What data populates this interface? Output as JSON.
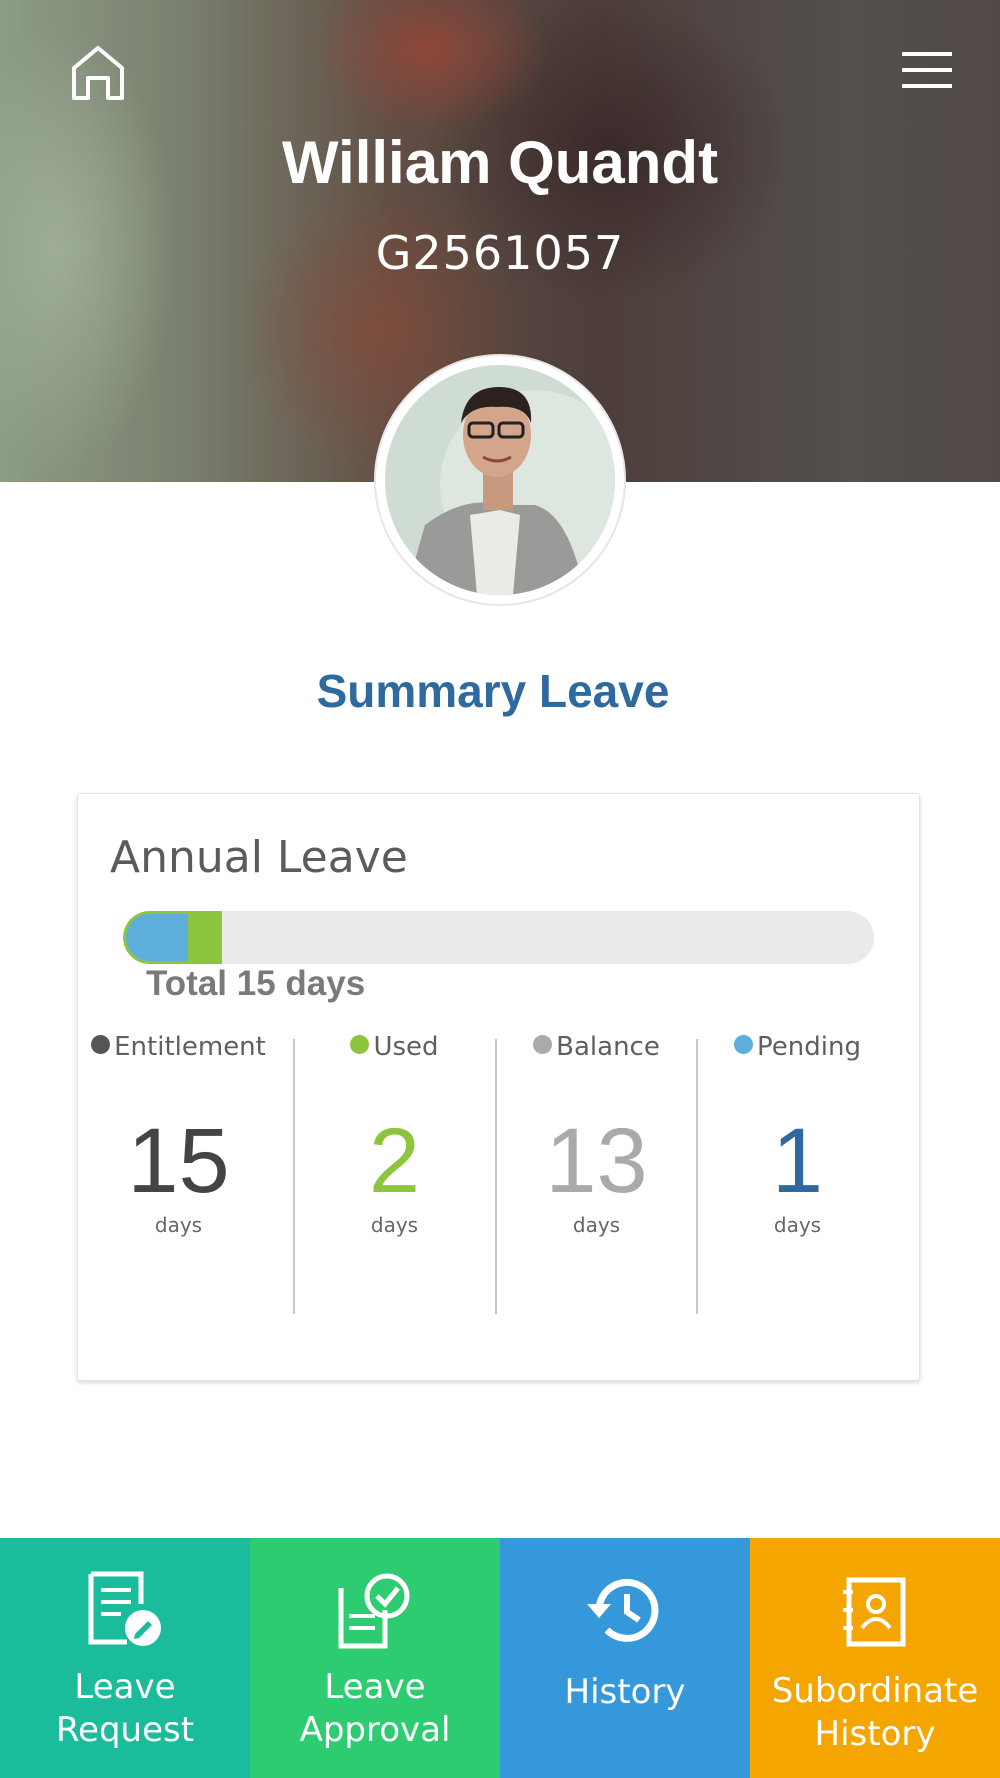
{
  "header": {
    "name": "William Quandt",
    "employee_id": "G2561057",
    "home_icon": "home-icon",
    "menu_icon": "hamburger-menu-icon"
  },
  "summary": {
    "title": "Summary Leave"
  },
  "annual_leave": {
    "title": "Annual Leave",
    "total_label": "Total 15 days",
    "bar": {
      "total_days": 15,
      "pending": 1,
      "used": 2
    },
    "stats": [
      {
        "label": "Entitlement",
        "value": "15",
        "unit": "days",
        "color": "#555555"
      },
      {
        "label": "Used",
        "value": "2",
        "unit": "days",
        "color": "#8cc63e"
      },
      {
        "label": "Balance",
        "value": "13",
        "unit": "days",
        "color": "#aaaaaa"
      },
      {
        "label": "Pending",
        "value": "1",
        "unit": "days",
        "color": "#5eaedb"
      }
    ]
  },
  "nav": [
    {
      "label": "Leave\nRequest",
      "icon": "leave-request-icon",
      "color": "#1abc9c"
    },
    {
      "label": "Leave\nApproval",
      "icon": "leave-approval-icon",
      "color": "#2ecc71"
    },
    {
      "label": "History",
      "icon": "history-icon",
      "color": "#3498db"
    },
    {
      "label": "Subordinate\nHistory",
      "icon": "contacts-book-icon",
      "color": "#f5a500"
    }
  ]
}
